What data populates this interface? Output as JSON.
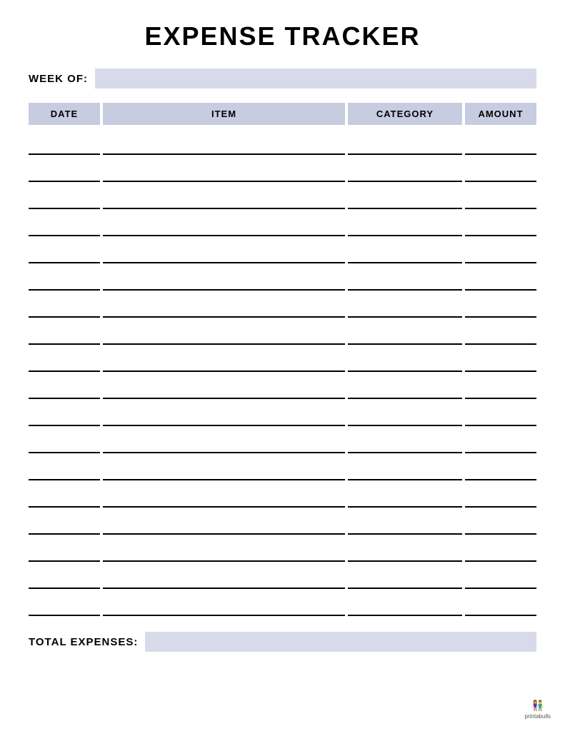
{
  "title": "EXPENSE TRACKER",
  "week_of": {
    "label": "WEEK OF:"
  },
  "table": {
    "headers": [
      {
        "label": "DATE"
      },
      {
        "label": "ITEM"
      },
      {
        "label": "CATEGORY"
      },
      {
        "label": "AMOUNT"
      }
    ],
    "rows": [
      {
        "date": "",
        "item": "",
        "category": "",
        "amount": ""
      },
      {
        "date": "",
        "item": "",
        "category": "",
        "amount": ""
      },
      {
        "date": "",
        "item": "",
        "category": "",
        "amount": ""
      },
      {
        "date": "",
        "item": "",
        "category": "",
        "amount": ""
      },
      {
        "date": "",
        "item": "",
        "category": "",
        "amount": ""
      },
      {
        "date": "",
        "item": "",
        "category": "",
        "amount": ""
      },
      {
        "date": "",
        "item": "",
        "category": "",
        "amount": ""
      },
      {
        "date": "",
        "item": "",
        "category": "",
        "amount": ""
      },
      {
        "date": "",
        "item": "",
        "category": "",
        "amount": ""
      },
      {
        "date": "",
        "item": "",
        "category": "",
        "amount": ""
      },
      {
        "date": "",
        "item": "",
        "category": "",
        "amount": ""
      },
      {
        "date": "",
        "item": "",
        "category": "",
        "amount": ""
      },
      {
        "date": "",
        "item": "",
        "category": "",
        "amount": ""
      },
      {
        "date": "",
        "item": "",
        "category": "",
        "amount": ""
      },
      {
        "date": "",
        "item": "",
        "category": "",
        "amount": ""
      },
      {
        "date": "",
        "item": "",
        "category": "",
        "amount": ""
      },
      {
        "date": "",
        "item": "",
        "category": "",
        "amount": ""
      },
      {
        "date": "",
        "item": "",
        "category": "",
        "amount": ""
      }
    ]
  },
  "total": {
    "label": "TOTAL EXPENSES:"
  },
  "watermark": {
    "text": "printabulls",
    "icon": "👥"
  }
}
